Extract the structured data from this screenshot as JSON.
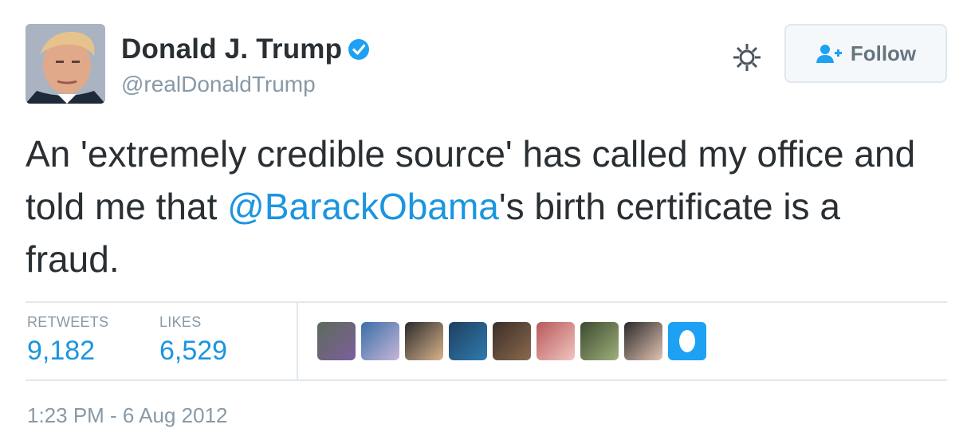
{
  "user": {
    "name": "Donald J. Trump",
    "handle": "@realDonaldTrump"
  },
  "actions": {
    "follow_label": "Follow"
  },
  "tweet": {
    "text_before": "An 'extremely credible source' has called my office and told me that ",
    "mention": "@BarackObama",
    "text_after": "'s birth certificate is a fraud."
  },
  "stats": {
    "retweets_label": "RETWEETS",
    "retweets_count": "9,182",
    "likes_label": "LIKES",
    "likes_count": "6,529"
  },
  "likers": [
    {
      "name": "liker-1",
      "color_a": "#5b6b5a",
      "color_b": "#7e5f9c"
    },
    {
      "name": "liker-2",
      "color_a": "#3a6ea8",
      "color_b": "#c8b6d8"
    },
    {
      "name": "liker-3",
      "color_a": "#2b2b2b",
      "color_b": "#d9b48c"
    },
    {
      "name": "liker-4",
      "color_a": "#1f3f5e",
      "color_b": "#2f7bb0"
    },
    {
      "name": "liker-5",
      "color_a": "#3b2e26",
      "color_b": "#8a6a4f"
    },
    {
      "name": "liker-6",
      "color_a": "#b8595a",
      "color_b": "#f0c5c0"
    },
    {
      "name": "liker-7",
      "color_a": "#3c4a2f",
      "color_b": "#9fb07c"
    },
    {
      "name": "liker-8",
      "color_a": "#2a2a2a",
      "color_b": "#e3c3b3"
    }
  ],
  "timestamp": "1:23 PM - 6 Aug 2012",
  "colors": {
    "link": "#1b95e0",
    "verified": "#1da1f2",
    "muted": "#8899a6",
    "text": "#292f33"
  }
}
